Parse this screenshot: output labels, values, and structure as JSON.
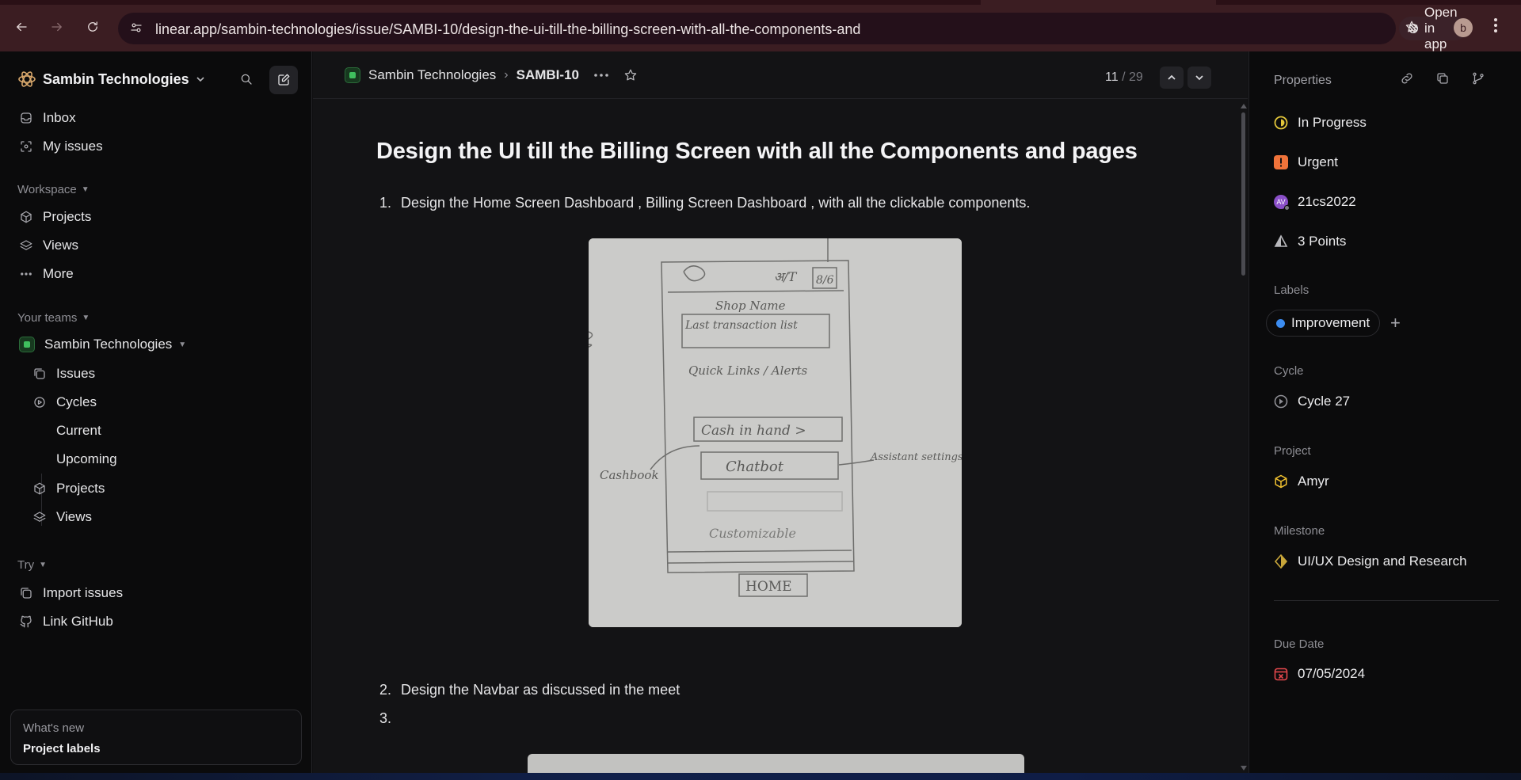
{
  "browser": {
    "url": "linear.app/sambin-technologies/issue/SAMBI-10/design-the-ui-till-the-billing-screen-with-all-the-components-and",
    "open_in_app": "Open in app",
    "profile_initial": "b"
  },
  "sidebar": {
    "workspace_name": "Sambin Technologies",
    "top_items": [
      "Inbox",
      "My issues"
    ],
    "workspace_section": "Workspace",
    "workspace_items": [
      "Projects",
      "Views",
      "More"
    ],
    "teams_section": "Your teams",
    "team_name": "Sambin Technologies",
    "team_items": [
      "Issues",
      "Cycles"
    ],
    "cycle_items": [
      "Current",
      "Upcoming"
    ],
    "team_items_after": [
      "Projects",
      "Views"
    ],
    "try_section": "Try",
    "try_items": [
      "Import issues",
      "Link GitHub"
    ],
    "whats_new": {
      "title": "What's new",
      "subtitle": "Project labels"
    }
  },
  "main": {
    "breadcrumb_team": "Sambin Technologies",
    "breadcrumb_separator": "›",
    "issue_id": "SAMBI-10",
    "counter_current": "11",
    "counter_total": "/ 29",
    "title": "Design the UI till the Billing Screen with all the Components and pages",
    "list": [
      {
        "num": "1.",
        "text": "Design the Home Screen Dashboard , Billing Screen Dashboard , with all the clickable components."
      },
      {
        "num": "2.",
        "text": "Design the Navbar as discussed in the meet"
      },
      {
        "num": "3.",
        "text": ""
      }
    ],
    "sketch_text": {
      "shop": "Shop Name",
      "last": "Last transaction list",
      "quick": "Quick Links / Alerts",
      "cash": "Cash in hand >",
      "chatbot": "Chatbot",
      "cashbook": "Cashbook",
      "assistant": "Assistant settings",
      "custom": "Customizable",
      "home": "HOME",
      "lang": "अ/T",
      "scan": "8/6"
    }
  },
  "properties": {
    "header": "Properties",
    "status": "In Progress",
    "priority": "Urgent",
    "assignee": "21cs2022",
    "assignee_initials": "AV",
    "estimate": "3 Points",
    "labels_label": "Labels",
    "label_chip": "Improvement",
    "add_symbol": "+",
    "cycle_label": "Cycle",
    "cycle": "Cycle 27",
    "project_label": "Project",
    "project": "Amyr",
    "milestone_label": "Milestone",
    "milestone": "UI/UX Design and Research",
    "due_label": "Due Date",
    "due": "07/05/2024"
  },
  "colors": {
    "chrome": "#3b1d22",
    "status_yellow": "#e2c63a",
    "urgent_orange": "#f0733a",
    "label_blue": "#3c8cf0",
    "team_green": "#3fbf5e",
    "due_red": "#e5484d"
  }
}
